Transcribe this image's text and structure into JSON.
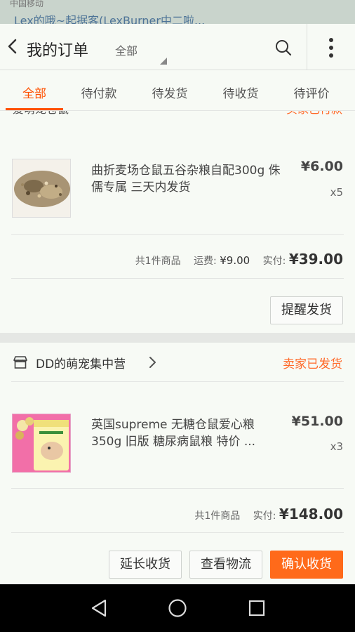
{
  "status_bar": {
    "carrier": "中国移动",
    "notification": "Lex的哦~起据客(LexBurner中二啦..."
  },
  "header": {
    "title": "我的订单",
    "filter": "全部"
  },
  "tabs": [
    {
      "label": "全部",
      "active": true
    },
    {
      "label": "待付款",
      "active": false
    },
    {
      "label": "待发货",
      "active": false
    },
    {
      "label": "待收货",
      "active": false
    },
    {
      "label": "待评价",
      "active": false
    }
  ],
  "orders": [
    {
      "shop_name": "爱萌宠仓鼠",
      "status": "买家已付款",
      "item": {
        "title": "曲折麦场仓鼠五谷杂粮自配300g 侏儒专属 三天内发货",
        "price": "¥6.00",
        "qty": "x5"
      },
      "summary": {
        "count_text": "共1件商品",
        "shipping_label": "运费:",
        "shipping_value": "¥9.00",
        "paid_label": "实付:",
        "paid_value": "¥39.00"
      },
      "buttons": [
        "提醒发货"
      ]
    },
    {
      "shop_name": "DD的萌宠集中营",
      "status": "卖家已发货",
      "item": {
        "title": "英国supreme 无糖仓鼠爱心粮350g 旧版 糖尿病鼠粮 特价 ...",
        "price": "¥51.00",
        "qty": "x3"
      },
      "summary": {
        "count_text": "共1件商品",
        "paid_label": "实付:",
        "paid_value": "¥148.00"
      },
      "buttons": [
        "延长收货",
        "查看物流",
        "确认收货"
      ]
    }
  ],
  "colors": {
    "accent": "#ff5000",
    "status": "#ff6a2a",
    "primary_button": "#ff6a1a",
    "background": "#f7faf5"
  },
  "icons": [
    "back-arrow-icon",
    "search-icon",
    "more-vertical-icon",
    "store-icon",
    "chevron-right-icon",
    "nav-back-icon",
    "nav-home-icon",
    "nav-recents-icon"
  ]
}
